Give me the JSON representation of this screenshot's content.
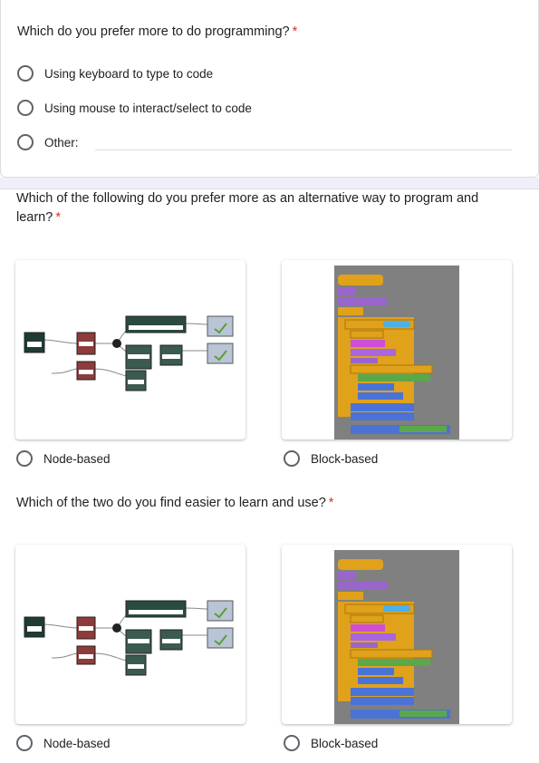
{
  "q1": {
    "title": "Which do you prefer more to do programming?",
    "required_mark": "*",
    "options": [
      {
        "label": "Using keyboard to type to code",
        "selected": false
      },
      {
        "label": "Using mouse to interact/select to code",
        "selected": false
      },
      {
        "label": "Other:",
        "selected": false
      }
    ]
  },
  "q2": {
    "title_line1": "Which of the following do you prefer more as an alternative way to program and",
    "title_line2": "learn?",
    "required_mark": "*",
    "options": [
      {
        "label": "Node-based",
        "selected": false
      },
      {
        "label": "Block-based",
        "selected": false
      }
    ]
  },
  "q3": {
    "title": "Which of the two do you find easier to learn and use?",
    "required_mark": "*",
    "options": [
      {
        "label": "Node-based",
        "selected": false
      },
      {
        "label": "Block-based",
        "selected": false
      }
    ]
  },
  "colors": {
    "accent": "#673ab7",
    "required": "#d93025",
    "section_gap": "#f1eefa"
  },
  "icons": [
    "radio-button-icon",
    "node-graph-image",
    "block-code-image"
  ]
}
